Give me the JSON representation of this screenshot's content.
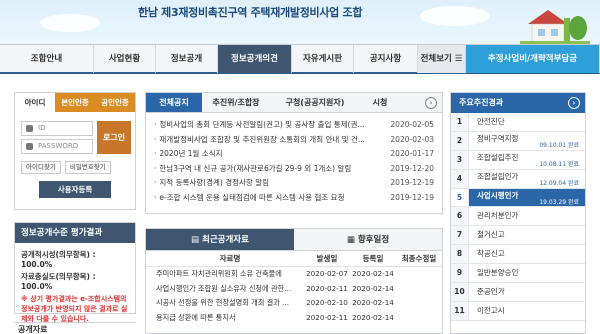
{
  "site": {
    "title": "한남 제3재정비촉진구역 주택재개발정비사업 조합"
  },
  "nav": [
    {
      "label": "조합안내",
      "w": 0
    },
    {
      "label": "사업현황"
    },
    {
      "label": "정보공개"
    },
    {
      "label": "정보공개의견"
    },
    {
      "label": "자유게시판"
    },
    {
      "label": "공지사항"
    },
    {
      "label": "전체보기 ☰"
    },
    {
      "label": "추정사업비/개략적부담금"
    }
  ],
  "login": {
    "tabs": [
      "아이디",
      "본인인증",
      "공인인증"
    ],
    "id_placeholder": "ID",
    "pw_placeholder": "PASSWORD",
    "login_label": "로그인",
    "find_id": "아이디찾기",
    "find_pw": "비밀번호찾기",
    "join": "사용자등록"
  },
  "eval": {
    "title": "정보공개수준 평가결과",
    "row1": "공개적시성(의무항목) : 100.0%",
    "row2": "자료충실도(의무항목) : 100.0%",
    "note": "※ 상기 평가결과는 e-조합시스템의 정보공개가 반영되지 않은 결과로 실제와 다를 수 있습니다."
  },
  "bottom_left": "공개자료",
  "notice_tabs": [
    "전체공지",
    "추진위/조합장",
    "구청(공공지원자)",
    "시청"
  ],
  "notices": [
    {
      "title": "정비사업의 총회 단계등 사전알림(권고) 및 공사장 출입 통제(권...",
      "date": "2020-02-05"
    },
    {
      "title": "재개발정비사업 조합장 및 추진위원장 소통회의 개최 안내 및 건...",
      "date": "2020-02-03"
    },
    {
      "title": "2020년 1월 소식지",
      "date": "2020-01-17"
    },
    {
      "title": "한남3구역 내 신규 공가(재사관로6가길 29-9 외 1개소) 알림",
      "date": "2019-12-20"
    },
    {
      "title": "지적 등록사항(경계) 경정사항 알림",
      "date": "2019-12-19"
    },
    {
      "title": "e-조합 시스템 운용 실태점검에 따른 시스템 사용 협조 요청",
      "date": "2019-12-19"
    }
  ],
  "recent": {
    "tabs": [
      "최근공개자료",
      "향후일정"
    ],
    "headers": [
      "자료명",
      "발생일",
      "등록일",
      "최종수정일"
    ],
    "rows": [
      {
        "name": "주미아파트 자치관리위원회 소유 건축물에",
        "occur": "2020-02-07",
        "reg": "2020-02-14",
        "mod": ""
      },
      {
        "name": "사업시행인가 조합원 실소유자 신청에 관한...",
        "occur": "2020-02-11",
        "reg": "2020-02-14",
        "mod": ""
      },
      {
        "name": "시공사 선정을 위한 현장설명회 개최 결과 ...",
        "occur": "2020-02-10",
        "reg": "2020-02-14",
        "mod": ""
      },
      {
        "name": "용지급 상환에 따른 통지서",
        "occur": "2020-02-11",
        "reg": "2020-02-14",
        "mod": ""
      }
    ]
  },
  "progress": {
    "title": "주요추진경과",
    "steps": [
      {
        "num": "1",
        "name": "안전진단",
        "date": ""
      },
      {
        "num": "2",
        "name": "정비구역지정",
        "date": "09.10.01 완료"
      },
      {
        "num": "3",
        "name": "조합설립추진",
        "date": "10.08.11 완료"
      },
      {
        "num": "4",
        "name": "조합설립인가",
        "date": "12.09.04 완료"
      },
      {
        "num": "5",
        "name": "사업시행인가",
        "date": "19.03.29 완료"
      },
      {
        "num": "6",
        "name": "관리처분인가",
        "date": ""
      },
      {
        "num": "7",
        "name": "철거신고",
        "date": ""
      },
      {
        "num": "8",
        "name": "착공신고",
        "date": ""
      },
      {
        "num": "9",
        "name": "일반분양승인",
        "date": ""
      },
      {
        "num": "10",
        "name": "준공인가",
        "date": ""
      },
      {
        "num": "11",
        "name": "이전고시",
        "date": ""
      }
    ]
  },
  "icons": {
    "more": "next-circle-icon",
    "schedule": "calendar-icon",
    "recent": "document-icon"
  }
}
